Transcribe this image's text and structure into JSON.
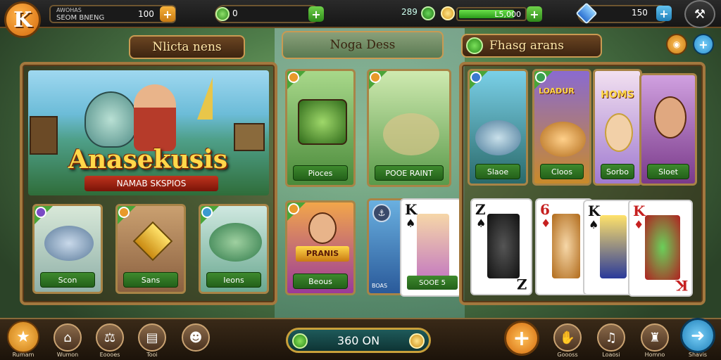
{
  "top_bar": {
    "player_name": "AWOHAS",
    "player_sub": "SEOM BNENG",
    "coins_value": "100",
    "gems_value": "0",
    "energy_level": "289",
    "energy_bar_text": "L5,000",
    "energy_fill_percent": 85,
    "tickets_value": "150"
  },
  "left_panel": {
    "header": "Nlicta nens",
    "hero_title": "Anasekusis",
    "hero_subtitle": "NAMAB SKSPIOS",
    "cards": [
      {
        "label": "Scon"
      },
      {
        "label": "Sans"
      },
      {
        "label": "Ieons"
      }
    ]
  },
  "middle_panel": {
    "header": "Noga Dess",
    "cards": [
      {
        "label": "Pioces"
      },
      {
        "label": "POOE RAINT"
      },
      {
        "label": "Beous"
      },
      {
        "label": "SOOE 5"
      }
    ],
    "hero_banner": "PRANIS",
    "side_text": "BOAS"
  },
  "right_panel": {
    "header": "Fhasg arans",
    "cards": [
      {
        "label": "Slaoe",
        "badge": ""
      },
      {
        "label": "Cloos",
        "badge": "LOADUR"
      },
      {
        "label": "Sorbo",
        "badge": "HOMS"
      },
      {
        "label": "Sloet",
        "badge": ""
      }
    ],
    "playing_cards": [
      {
        "rank": "Z",
        "suit": "♠",
        "color": "#111"
      },
      {
        "rank": "6",
        "suit": "♦",
        "color": "#c62020"
      },
      {
        "rank": "K",
        "suit": "♠",
        "color": "#111"
      },
      {
        "rank": "K",
        "suit": "♦",
        "color": "#c62020"
      }
    ],
    "mid_card": {
      "rank": "K",
      "suit": "♠"
    }
  },
  "bottom_bar": {
    "center_value": "360 ON",
    "nav_left": [
      {
        "label": "Rumam",
        "icon": "star-icon"
      },
      {
        "label": "Wumon",
        "icon": "building-icon"
      },
      {
        "label": "Eoooes",
        "icon": "scale-icon"
      },
      {
        "label": "Tooi",
        "icon": "scroll-icon"
      },
      {
        "label": "",
        "icon": "robot-icon"
      }
    ],
    "nav_right": [
      {
        "label": "",
        "icon": "plus-icon"
      },
      {
        "label": "Goooss",
        "icon": "hand-icon"
      },
      {
        "label": "Loaosi",
        "icon": "bell-icon"
      },
      {
        "label": "Homno",
        "icon": "tower-icon"
      },
      {
        "label": "Shavis",
        "icon": "arrow-icon"
      }
    ]
  },
  "colors": {
    "accent_orange": "#e8901f",
    "accent_green": "#3e8a2e",
    "frame_gold": "#a3783e",
    "accent_blue": "#2a8fd0"
  }
}
